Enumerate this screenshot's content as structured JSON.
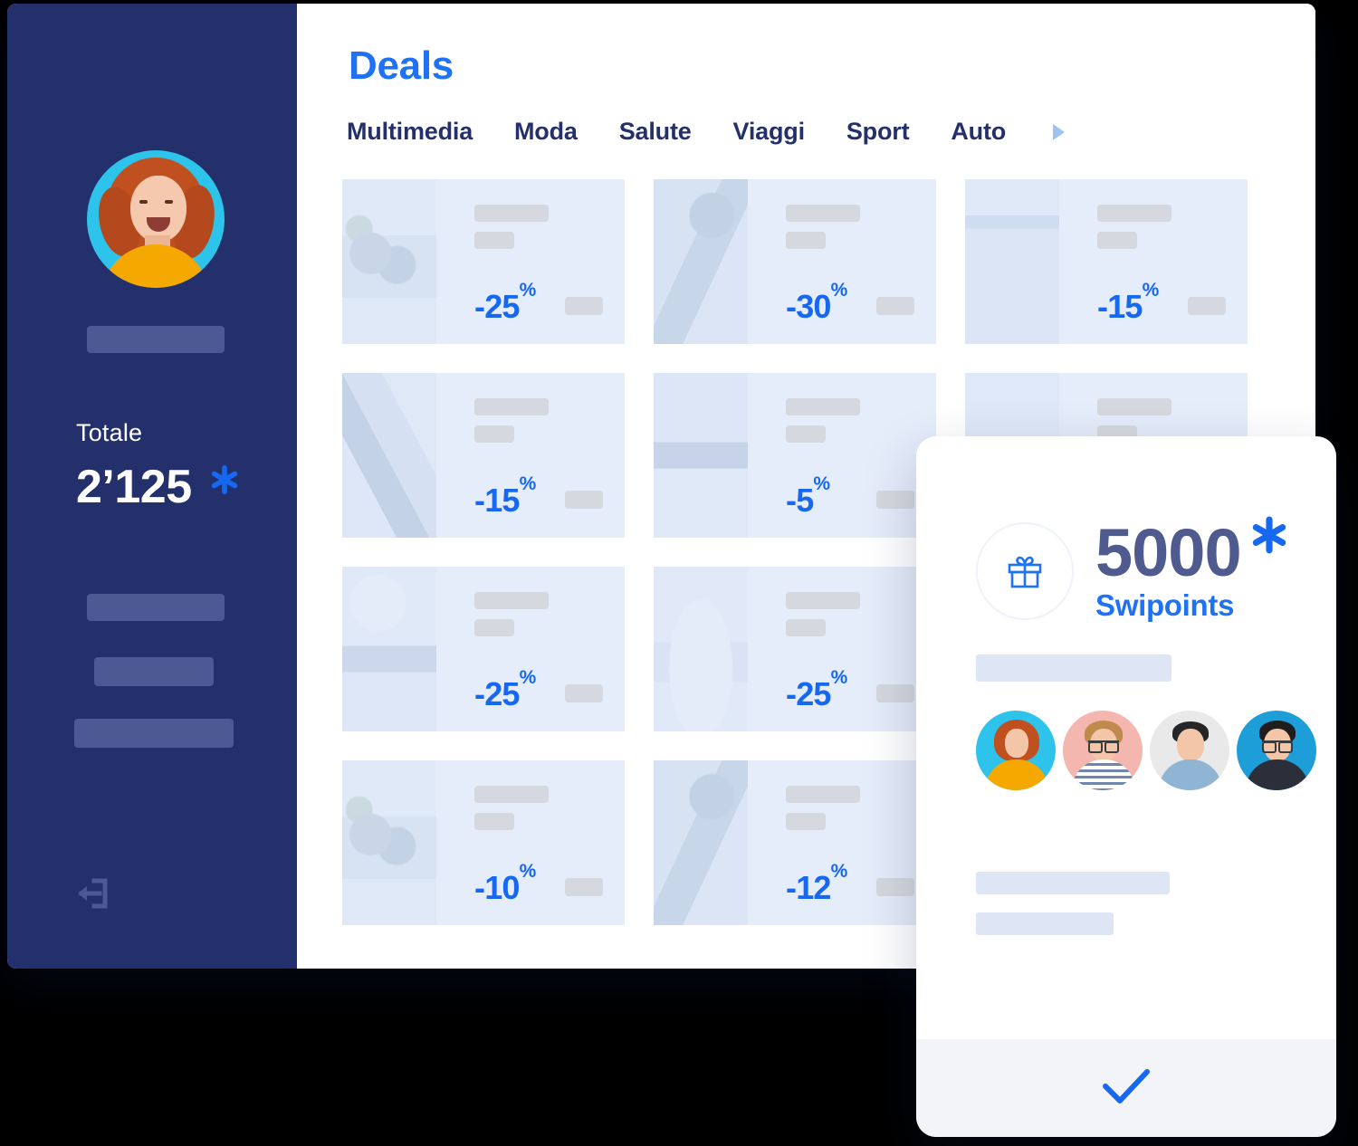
{
  "sidebar": {
    "avatar_alt": "user-avatar",
    "name_placeholder": "",
    "totale_label": "Totale",
    "totale_value": "2’125",
    "points_symbol": "asterisk",
    "nav_placeholders": [
      "",
      "",
      ""
    ],
    "logout_icon": "logout-icon",
    "background_color": "#24306b",
    "placeholder_color": "#4d5992"
  },
  "main": {
    "title": "Deals",
    "title_color": "#1f72f4",
    "tabs": [
      {
        "label": "Multimedia"
      },
      {
        "label": "Moda"
      },
      {
        "label": "Salute"
      },
      {
        "label": "Viaggi"
      },
      {
        "label": "Sport"
      },
      {
        "label": "Auto"
      }
    ],
    "tabs_next_icon": "chevron-right-icon",
    "tab_color": "#24306b",
    "deal_card_bg": "#e5ecfa",
    "deal_discount_color": "#1668f0",
    "deals": [
      {
        "discount": "-25",
        "unit": "%",
        "image": "img-veg"
      },
      {
        "discount": "-30",
        "unit": "%",
        "image": "img-gym"
      },
      {
        "discount": "-15",
        "unit": "%",
        "image": "img-kitchen"
      },
      {
        "discount": "-15",
        "unit": "%",
        "image": "img-train"
      },
      {
        "discount": "-5",
        "unit": "%",
        "image": "img-beach"
      },
      {
        "discount": "",
        "unit": "",
        "image": "img-blank"
      },
      {
        "discount": "-25",
        "unit": "%",
        "image": "img-mixer"
      },
      {
        "discount": "-25",
        "unit": "%",
        "image": "img-smile"
      },
      {
        "discount": "-10",
        "unit": "%",
        "image": "img-veg"
      },
      {
        "discount": "-12",
        "unit": "%",
        "image": "img-gym"
      }
    ]
  },
  "modal": {
    "gift_icon": "gift-icon",
    "points": "5000",
    "points_symbol": "asterisk",
    "points_color": "#4f5b8f",
    "subtitle": "Swipoints",
    "subtitle_color": "#1f72f4",
    "placeholders": [
      "",
      "",
      ""
    ],
    "avatars": [
      {
        "name": "avatar-woman-red-hair",
        "bg": "#2dc3ea",
        "hair": "#c0501f",
        "body": "#f5a800",
        "glasses": false
      },
      {
        "name": "avatar-man-curly",
        "bg": "#f3b7b0",
        "hair": "#c08a4e",
        "body": "#d9e2ef",
        "glasses": true
      },
      {
        "name": "avatar-man-denim",
        "bg": "#e9e9e9",
        "hair": "#262626",
        "body": "#8fb4d4",
        "glasses": false
      },
      {
        "name": "avatar-man-glasses",
        "bg": "#1d9ed9",
        "hair": "#201d1d",
        "body": "#2b2f3a",
        "glasses": true
      }
    ],
    "confirm_icon": "check-icon",
    "confirm_icon_color": "#1668f0",
    "footer_bg": "#f2f4f7"
  }
}
